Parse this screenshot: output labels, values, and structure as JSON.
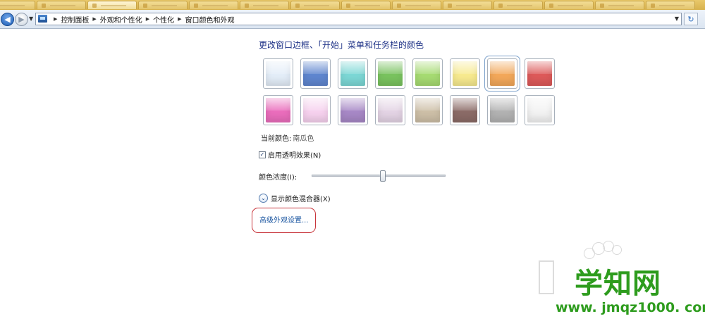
{
  "address_bar": {
    "breadcrumbs": [
      "控制面板",
      "外观和个性化",
      "个性化",
      "窗口颜色和外观"
    ]
  },
  "main": {
    "heading": "更改窗口边框、「开始」菜单和任务栏的颜色",
    "swatches": [
      {
        "color": "#e3edf8"
      },
      {
        "color": "#5f86cf"
      },
      {
        "color": "#7cd7d5"
      },
      {
        "color": "#79c35f"
      },
      {
        "color": "#a6db72"
      },
      {
        "color": "#f7ea8f"
      },
      {
        "color": "#f3a85a",
        "selected": true
      },
      {
        "color": "#dd5a5a"
      },
      {
        "color": "#ea6dbc"
      },
      {
        "color": "#f6d1ee"
      },
      {
        "color": "#a788c6"
      },
      {
        "color": "#e3d3e4"
      },
      {
        "color": "#cdbfa7"
      },
      {
        "color": "#8b6b67"
      },
      {
        "color": "#b2b2b2"
      },
      {
        "color": "#f2f2f2"
      }
    ],
    "current_color_label": "当前颜色:",
    "current_color_value": "南瓜色",
    "transparency_label": "启用透明效果(N)",
    "transparency_checked": true,
    "intensity_label": "颜色浓度(I):",
    "intensity_value": 0.53,
    "mixer_label": "显示颜色混合器(X)",
    "advanced_link": "高级外观设置..."
  },
  "watermark": {
    "text": "学知网",
    "url": "www. jmqz1000. com"
  }
}
